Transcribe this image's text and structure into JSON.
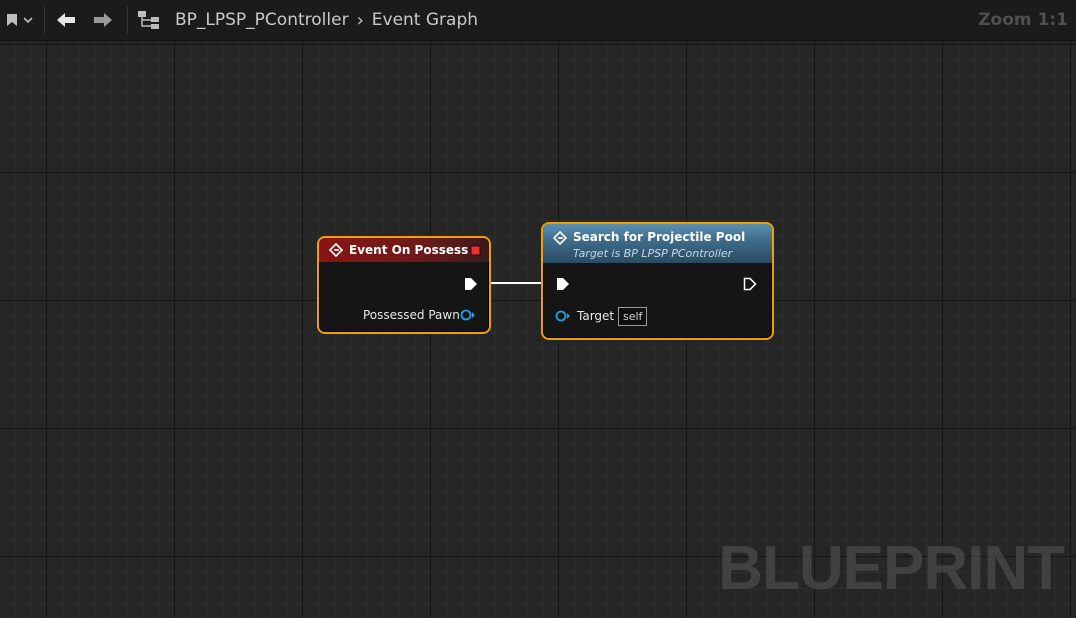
{
  "toolbar": {
    "breadcrumb": {
      "blueprint": "BP_LPSP_PController",
      "graph": "Event Graph"
    },
    "zoom": "Zoom 1:1"
  },
  "nodes": {
    "event_on_possess": {
      "title": "Event On Possess",
      "output_pin_label": "Possessed Pawn"
    },
    "search_projectile_pool": {
      "title": "Search for Projectile Pool",
      "subtitle": "Target is BP LPSP PController",
      "target_pin_label": "Target",
      "target_default": "self"
    }
  },
  "watermark": "BLUEPRINT",
  "colors": {
    "selection": "#f0a000",
    "event_header": "#8a1414",
    "function_header": "#4a7fa0",
    "object_pin": "#1ea0e6",
    "exec_wire": "#ffffff"
  },
  "icons": [
    "bookmark-icon",
    "chevron-down-icon",
    "back-arrow-icon",
    "forward-arrow-icon",
    "hierarchy-icon",
    "event-icon",
    "function-icon",
    "delegate-pin-icon",
    "exec-pin-icon",
    "object-pin-icon"
  ]
}
